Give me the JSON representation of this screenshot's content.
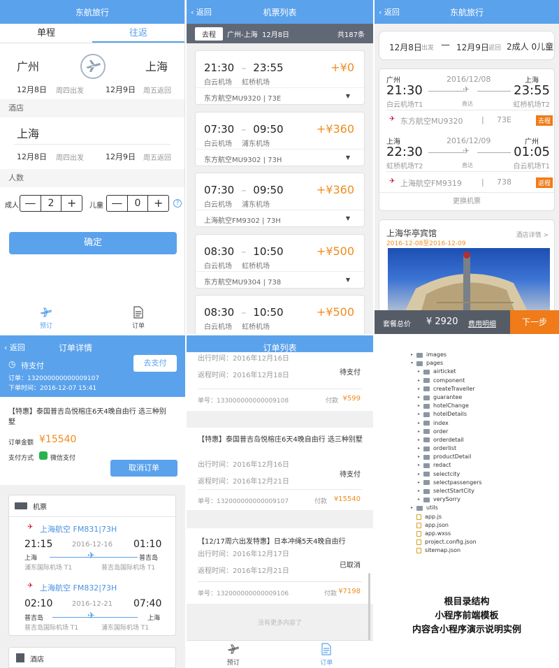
{
  "p1": {
    "title": "东航旅行",
    "tab_oneway": "单程",
    "tab_round": "往返",
    "from_city": "广州",
    "to_city": "上海",
    "depart_date": "12月8日",
    "depart_day": "周四出发",
    "return_date": "12月9日",
    "return_day": "周五返回",
    "hotel_label": "酒店",
    "hotel_city": "上海",
    "checkin_date": "12月8日",
    "checkin_day": "周四出发",
    "checkout_date": "12月9日",
    "checkout_day": "周五返回",
    "people_label": "人数",
    "adult_label": "成人",
    "adult_count": "2",
    "child_label": "儿童",
    "child_count": "0",
    "minus": "—",
    "plus": "+",
    "help": "?",
    "confirm": "确定",
    "nav_book": "预订",
    "nav_order": "订单"
  },
  "p2": {
    "back": "返回",
    "title": "机票列表",
    "tag": "去程",
    "route": "广州-上海",
    "date": "12月8日",
    "total": "共187条",
    "flights": [
      {
        "dep": "21:30",
        "arr": "23:55",
        "dep_ap": "白云机场",
        "arr_ap": "虹桥机场",
        "price": "+¥0",
        "info": "东方航空MU9320 | 73E"
      },
      {
        "dep": "07:30",
        "arr": "09:50",
        "dep_ap": "白云机场",
        "arr_ap": "浦东机场",
        "price": "+¥360",
        "info": "东方航空MU9302 | 73H"
      },
      {
        "dep": "07:30",
        "arr": "09:50",
        "dep_ap": "白云机场",
        "arr_ap": "浦东机场",
        "price": "+¥360",
        "info": "上海航空FM9302 | 73H"
      },
      {
        "dep": "08:30",
        "arr": "10:50",
        "dep_ap": "白云机场",
        "arr_ap": "虹桥机场",
        "price": "+¥500",
        "info": "东方航空MU9304 | 738"
      },
      {
        "dep": "08:30",
        "arr": "10:50",
        "dep_ap": "白云机场",
        "arr_ap": "虹桥机场",
        "price": "+¥500",
        "info": ""
      }
    ]
  },
  "p3": {
    "back": "返回",
    "title": "东航旅行",
    "d1": "12月8日",
    "d1_sub": "出发",
    "d2": "12月9日",
    "d2_sub": "返回",
    "people": "2成人 0儿童",
    "out": {
      "from": "广州",
      "date": "2016/12/08",
      "to": "上海",
      "dep": "21:30",
      "arr": "23:55",
      "dep_ap": "白云机场T1",
      "direct": "直达",
      "arr_ap": "虹桥机场T2",
      "airline": "东方航空MU9320",
      "sep": "|",
      "plane": "73E",
      "tag": "去程"
    },
    "ret": {
      "from": "上海",
      "date": "2016/12/09",
      "to": "广州",
      "dep": "22:30",
      "arr": "01:05",
      "dep_ap": "虹桥机场T2",
      "direct": "直达",
      "arr_ap": "白云机场T1",
      "airline": "上海航空FM9319",
      "sep": "|",
      "plane": "738",
      "tag": "返程"
    },
    "change": "更换机票",
    "hotel_name": "上海华亭宾馆",
    "hotel_detail": "酒店详情 >",
    "hotel_dates": "2016-12-08至2016-12-09",
    "price_label": "套餐总价",
    "price": "¥ 2920",
    "fee_detail": "费用明细",
    "next": "下一步"
  },
  "p4": {
    "back": "返回",
    "title": "订单详情",
    "status": "待支付",
    "order_no": "订单：132000000000009107",
    "order_time": "下单时间：2016-12-07 15:41",
    "pay_btn": "去支付",
    "product": "【特惠】泰国普吉岛悦榕庄6天4晚自由行 选三种别墅",
    "amount_label": "订单金额",
    "amount": "¥15540",
    "pay_method_label": "支付方式",
    "pay_method": "微信支付",
    "cancel_btn": "取消订单",
    "ticket_label": "机票",
    "leg1": {
      "airline": "上海航空 FM831|73H",
      "dep": "21:15",
      "date": "2016-12-16",
      "arr": "01:10",
      "from": "上海",
      "to": "普吉岛",
      "from_ap": "浦东国际机场 T1",
      "to_ap": "普吉岛国际机场 T1"
    },
    "leg2": {
      "airline": "上海航空 FM832|73H",
      "dep": "02:10",
      "date": "2016-12-21",
      "arr": "07:40",
      "from": "普吉岛",
      "to": "上海",
      "from_ap": "普吉岛国际机场 T1",
      "to_ap": "浦东国际机场 T1"
    },
    "hotel_label": "酒店"
  },
  "p5": {
    "title": "订单列表",
    "o1": {
      "dep": "出行时间：2016年12月16日",
      "ret": "返程时间：2016年12月18日",
      "status": "待支付",
      "no": "单号：133000000000009108",
      "pay": "付款",
      "amount": "¥599"
    },
    "o2": {
      "title": "【特惠】泰国普吉岛悦榕庄6天4晚自由行 选三种别墅",
      "dep": "出行时间：2016年12月16日",
      "ret": "返程时间：2016年12月21日",
      "status": "待支付",
      "no": "单号：132000000000009107",
      "pay": "付款",
      "amount": "¥15540"
    },
    "o3": {
      "title": "【12/17周六出发特惠】日本冲绳5天4晚自由行",
      "dep": "出行时间：2016年12月17日",
      "ret": "返程时间：2016年12月21日",
      "status": "已取消",
      "no": "单号：132000000000009106",
      "pay": "付款",
      "amount": "¥7198"
    },
    "end": "没有更多内容了",
    "nav_book": "预订",
    "nav_order": "订单"
  },
  "p6": {
    "tree": [
      {
        "indent": 0,
        "type": "folder",
        "tri": "▸",
        "name": "images"
      },
      {
        "indent": 0,
        "type": "folder",
        "tri": "▾",
        "name": "pages"
      },
      {
        "indent": 1,
        "type": "folder",
        "tri": "▸",
        "name": "airticket"
      },
      {
        "indent": 1,
        "type": "folder",
        "tri": "▸",
        "name": "component"
      },
      {
        "indent": 1,
        "type": "folder",
        "tri": "▸",
        "name": "createTraveller"
      },
      {
        "indent": 1,
        "type": "folder",
        "tri": "▸",
        "name": "guarantee"
      },
      {
        "indent": 1,
        "type": "folder",
        "tri": "▸",
        "name": "hotelChange"
      },
      {
        "indent": 1,
        "type": "folder",
        "tri": "▸",
        "name": "hotelDetails"
      },
      {
        "indent": 1,
        "type": "folder",
        "tri": "▸",
        "name": "index"
      },
      {
        "indent": 1,
        "type": "folder",
        "tri": "▸",
        "name": "order"
      },
      {
        "indent": 1,
        "type": "folder",
        "tri": "▸",
        "name": "orderdetail"
      },
      {
        "indent": 1,
        "type": "folder",
        "tri": "▸",
        "name": "orderlist"
      },
      {
        "indent": 1,
        "type": "folder",
        "tri": "▸",
        "name": "productDetail"
      },
      {
        "indent": 1,
        "type": "folder",
        "tri": "▸",
        "name": "redact"
      },
      {
        "indent": 1,
        "type": "folder",
        "tri": "▸",
        "name": "selectcity"
      },
      {
        "indent": 1,
        "type": "folder",
        "tri": "▸",
        "name": "selectpassengers"
      },
      {
        "indent": 1,
        "type": "folder",
        "tri": "▸",
        "name": "selectStartCity"
      },
      {
        "indent": 1,
        "type": "folder",
        "tri": "▸",
        "name": "verySorry"
      },
      {
        "indent": 0,
        "type": "folder",
        "tri": "▸",
        "name": "utils"
      },
      {
        "indent": 0,
        "type": "file",
        "tri": "",
        "name": "app.js"
      },
      {
        "indent": 0,
        "type": "file",
        "tri": "",
        "name": "app.json"
      },
      {
        "indent": 0,
        "type": "file",
        "tri": "",
        "name": "app.wxss"
      },
      {
        "indent": 0,
        "type": "file",
        "tri": "",
        "name": "project.config.json"
      },
      {
        "indent": 0,
        "type": "file",
        "tri": "",
        "name": "sitemap.json"
      }
    ],
    "caption1": "根目录结构",
    "caption2": "小程序前端模板",
    "caption3": "内容含小程序演示说明实例"
  }
}
